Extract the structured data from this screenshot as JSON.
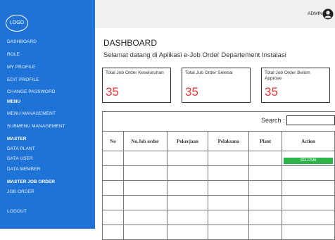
{
  "logo_text": "LOGO",
  "sidebar": {
    "items": [
      {
        "label": "DASHBOARD",
        "section": false
      },
      {
        "label": "ROLE",
        "section": false
      },
      {
        "label": "MY PROFILE",
        "section": false
      },
      {
        "label": "EDIT PROFILE",
        "section": false
      },
      {
        "label": "CHANGE PASSWORD",
        "section": false
      },
      {
        "label": "MENU",
        "section": true
      },
      {
        "label": "MENU MANAGEMENT",
        "section": false
      },
      {
        "label": "SUBMENU MANAGEMENT",
        "section": false
      },
      {
        "label": "MASTER",
        "section": true
      },
      {
        "label": "DATA PLANT",
        "section": false
      },
      {
        "label": "DATA USER",
        "section": false
      },
      {
        "label": "DATA MEMBER",
        "section": false
      },
      {
        "label": "MASTER JOB ORDER",
        "section": true
      },
      {
        "label": "JOB ORDER",
        "section": false
      },
      {
        "label": "LOGOUT",
        "section": false
      }
    ]
  },
  "header": {
    "user_label": "ADMIN",
    "user_icon": "user-circle-icon"
  },
  "main": {
    "title": "DASHBOARD",
    "welcome": "Selamat datang di Aplikasi e-Job Order Departement Instalasi",
    "cards": [
      {
        "label": "Total Job Order Keseluruhan",
        "value": "35"
      },
      {
        "label": "Total Job Order Selesai",
        "value": "35"
      },
      {
        "label": "Total Job Order Belum Approve",
        "value": "35"
      }
    ],
    "search_label": "Search :",
    "search_value": "",
    "table": {
      "headers": [
        "No",
        "No.Job order",
        "Pekerjaan",
        "Pelaksana",
        "Plant",
        "Action"
      ],
      "action_label": "SELESAI",
      "empty_row_count": 6
    }
  },
  "colors": {
    "sidebar": "#1f72d6",
    "card_value": "#e53935",
    "action_button": "#2bb44a"
  }
}
